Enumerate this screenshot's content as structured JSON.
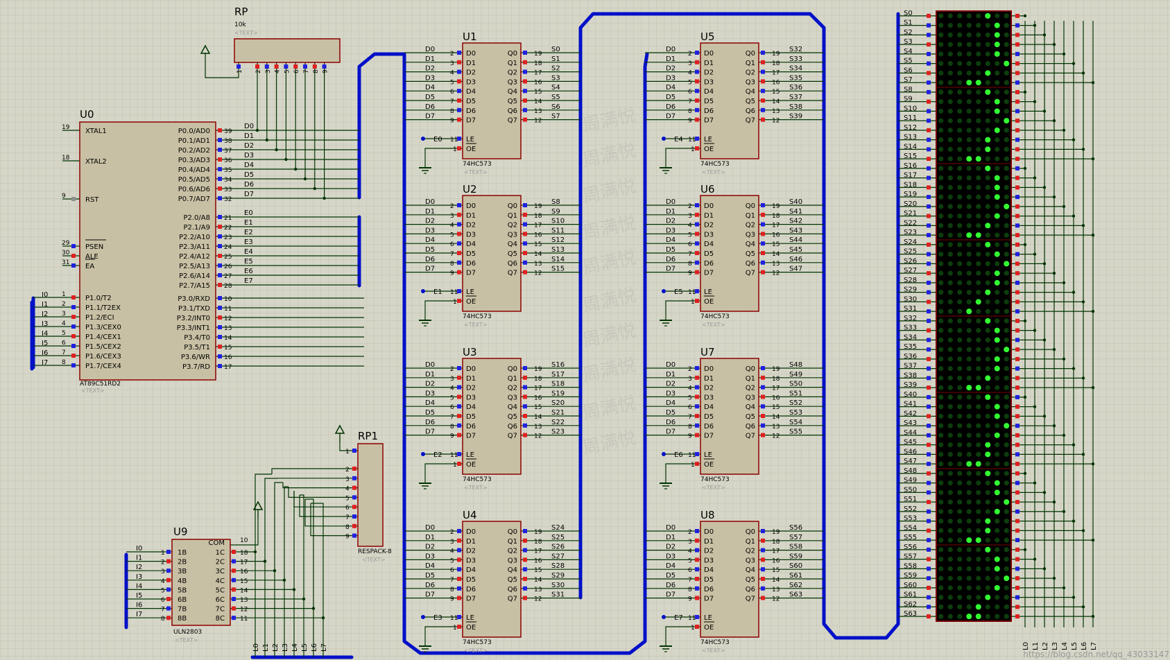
{
  "schematic": {
    "mcu": {
      "ref": "U0",
      "part": "AT89C51RD2",
      "text_placeholder": "<TEXT>",
      "left_pins": [
        {
          "num": "19",
          "name": "XTAL1"
        },
        {
          "num": "18",
          "name": "XTAL2"
        },
        {
          "num": "9",
          "name": "RST"
        },
        {
          "num": "29",
          "name": "PSEN"
        },
        {
          "num": "30",
          "name": "ALE"
        },
        {
          "num": "31",
          "name": "EA"
        },
        {
          "num": "1",
          "name": "P1.0/T2"
        },
        {
          "num": "2",
          "name": "P1.1/T2EX"
        },
        {
          "num": "3",
          "name": "P1.2/ECI"
        },
        {
          "num": "4",
          "name": "P1.3/CEX0"
        },
        {
          "num": "5",
          "name": "P1.4/CEX1"
        },
        {
          "num": "6",
          "name": "P1.5/CEX2"
        },
        {
          "num": "7",
          "name": "P1.6/CEX3"
        },
        {
          "num": "8",
          "name": "P1.7/CEX4"
        }
      ],
      "right_pins": [
        {
          "num": "39",
          "name": "P0.0/AD0",
          "net": "D0"
        },
        {
          "num": "38",
          "name": "P0.1/AD1",
          "net": "D1"
        },
        {
          "num": "37",
          "name": "P0.2/AD2",
          "net": "D2"
        },
        {
          "num": "36",
          "name": "P0.3/AD3",
          "net": "D3"
        },
        {
          "num": "35",
          "name": "P0.4/AD4",
          "net": "D4"
        },
        {
          "num": "34",
          "name": "P0.5/AD5",
          "net": "D5"
        },
        {
          "num": "33",
          "name": "P0.6/AD6",
          "net": "D6"
        },
        {
          "num": "32",
          "name": "P0.7/AD7",
          "net": "D7"
        },
        {
          "num": "21",
          "name": "P2.0/A8",
          "net": "E0"
        },
        {
          "num": "22",
          "name": "P2.1/A9",
          "net": "E1"
        },
        {
          "num": "23",
          "name": "P2.2/A10",
          "net": "E2"
        },
        {
          "num": "24",
          "name": "P2.3/A11",
          "net": "E3"
        },
        {
          "num": "25",
          "name": "P2.4/A12",
          "net": "E4"
        },
        {
          "num": "26",
          "name": "P2.5/A13",
          "net": "E5"
        },
        {
          "num": "27",
          "name": "P2.6/A14",
          "net": "E6"
        },
        {
          "num": "28",
          "name": "P2.7/A15",
          "net": "E7"
        },
        {
          "num": "10",
          "name": "P3.0/RXD",
          "net": ""
        },
        {
          "num": "11",
          "name": "P3.1/TXD",
          "net": ""
        },
        {
          "num": "12",
          "name": "P3.2/INT0",
          "net": ""
        },
        {
          "num": "13",
          "name": "P3.3/INT1",
          "net": ""
        },
        {
          "num": "14",
          "name": "P3.4/T0",
          "net": ""
        },
        {
          "num": "15",
          "name": "P3.5/T1",
          "net": ""
        },
        {
          "num": "16",
          "name": "P3.6/WR",
          "net": ""
        },
        {
          "num": "17",
          "name": "P3.7/RD",
          "net": ""
        }
      ],
      "p1_nets": [
        "I0",
        "I1",
        "I2",
        "I3",
        "I4",
        "I5",
        "I6",
        "I7"
      ]
    },
    "rp": {
      "ref": "RP",
      "value": "10k",
      "text_placeholder": "<TEXT>",
      "pins": [
        "1",
        "2",
        "3",
        "4",
        "5",
        "6",
        "7",
        "8",
        "9"
      ]
    },
    "rp1": {
      "ref": "RP1",
      "part": "RESPACK-8",
      "text_placeholder": "<TEXT>",
      "pins": [
        "1",
        "2",
        "3",
        "4",
        "5",
        "6",
        "7",
        "8",
        "9"
      ]
    },
    "uln": {
      "ref": "U9",
      "part": "ULN2803",
      "text_placeholder": "<TEXT>",
      "in_pins": [
        {
          "num": "1",
          "name": "1B",
          "net": "I0"
        },
        {
          "num": "2",
          "name": "2B",
          "net": "I1"
        },
        {
          "num": "3",
          "name": "3B",
          "net": "I2"
        },
        {
          "num": "4",
          "name": "4B",
          "net": "I3"
        },
        {
          "num": "5",
          "name": "5B",
          "net": "I4"
        },
        {
          "num": "6",
          "name": "6B",
          "net": "I5"
        },
        {
          "num": "7",
          "name": "7B",
          "net": "I6"
        },
        {
          "num": "8",
          "name": "8B",
          "net": "I7"
        }
      ],
      "com": {
        "num": "10",
        "name": "COM"
      },
      "out_pins": [
        {
          "num": "18",
          "name": "1C"
        },
        {
          "num": "17",
          "name": "2C"
        },
        {
          "num": "16",
          "name": "3C"
        },
        {
          "num": "15",
          "name": "4C"
        },
        {
          "num": "14",
          "name": "5C"
        },
        {
          "num": "13",
          "name": "6C"
        },
        {
          "num": "12",
          "name": "7C"
        },
        {
          "num": "11",
          "name": "8C"
        }
      ],
      "l_nets": [
        "L0",
        "L1",
        "L2",
        "L3",
        "L4",
        "L5",
        "L6",
        "L7"
      ]
    },
    "latch_common": {
      "part": "74HC573",
      "text_placeholder": "<TEXT>",
      "d_pins": [
        "2",
        "3",
        "4",
        "5",
        "6",
        "7",
        "8",
        "9"
      ],
      "q_pins": [
        "19",
        "18",
        "17",
        "16",
        "15",
        "14",
        "13",
        "12"
      ],
      "d_names": [
        "D0",
        "D1",
        "D2",
        "D3",
        "D4",
        "D5",
        "D6",
        "D7"
      ],
      "q_names": [
        "Q0",
        "Q1",
        "Q2",
        "Q3",
        "Q4",
        "Q5",
        "Q6",
        "Q7"
      ],
      "le": {
        "num": "11",
        "name": "LE"
      },
      "oe": {
        "num": "1",
        "name": "OE"
      }
    },
    "latches": [
      {
        "ref": "U1",
        "enable": "E0",
        "outputs": [
          "S0",
          "S1",
          "S2",
          "S3",
          "S4",
          "S5",
          "S6",
          "S7"
        ]
      },
      {
        "ref": "U2",
        "enable": "E1",
        "outputs": [
          "S8",
          "S9",
          "S10",
          "S11",
          "S12",
          "S13",
          "S14",
          "S15"
        ]
      },
      {
        "ref": "U3",
        "enable": "E2",
        "outputs": [
          "S16",
          "S17",
          "S18",
          "S19",
          "S20",
          "S21",
          "S22",
          "S23"
        ]
      },
      {
        "ref": "U4",
        "enable": "E3",
        "outputs": [
          "S24",
          "S25",
          "S26",
          "S27",
          "S28",
          "S29",
          "S30",
          "S31"
        ]
      },
      {
        "ref": "U5",
        "enable": "E4",
        "outputs": [
          "S32",
          "S33",
          "S34",
          "S35",
          "S36",
          "S37",
          "S38",
          "S39"
        ]
      },
      {
        "ref": "U6",
        "enable": "E5",
        "outputs": [
          "S40",
          "S41",
          "S42",
          "S43",
          "S44",
          "S45",
          "S46",
          "S47"
        ]
      },
      {
        "ref": "U7",
        "enable": "E6",
        "outputs": [
          "S48",
          "S49",
          "S50",
          "S51",
          "S52",
          "S53",
          "S54",
          "S55"
        ]
      },
      {
        "ref": "U8",
        "enable": "E7",
        "outputs": [
          "S56",
          "S57",
          "S58",
          "S59",
          "S60",
          "S61",
          "S62",
          "S63"
        ]
      }
    ],
    "matrix": {
      "rows": 64,
      "cols": 8,
      "bottom_nets": [
        "L0",
        "L1",
        "L2",
        "L3",
        "L4",
        "L5",
        "L6",
        "L7"
      ],
      "lit": [
        [
          0,
          5
        ],
        [
          1,
          6
        ],
        [
          2,
          6
        ],
        [
          3,
          6
        ],
        [
          4,
          6
        ],
        [
          5,
          7
        ],
        [
          6,
          5
        ],
        [
          7,
          3
        ],
        [
          7,
          4
        ],
        [
          8,
          5
        ],
        [
          9,
          6
        ],
        [
          10,
          6
        ],
        [
          11,
          7
        ],
        [
          12,
          6
        ],
        [
          13,
          5
        ],
        [
          14,
          5
        ],
        [
          15,
          3
        ],
        [
          15,
          4
        ],
        [
          16,
          5
        ],
        [
          17,
          6
        ],
        [
          18,
          6
        ],
        [
          19,
          6
        ],
        [
          20,
          7
        ],
        [
          21,
          6
        ],
        [
          22,
          5
        ],
        [
          23,
          3
        ],
        [
          23,
          4
        ],
        [
          24,
          5
        ],
        [
          25,
          6
        ],
        [
          26,
          7
        ],
        [
          27,
          6
        ],
        [
          28,
          6
        ],
        [
          29,
          5
        ],
        [
          30,
          4
        ],
        [
          31,
          3
        ],
        [
          32,
          5
        ],
        [
          33,
          6
        ],
        [
          34,
          6
        ],
        [
          35,
          7
        ],
        [
          36,
          6
        ],
        [
          37,
          6
        ],
        [
          38,
          5
        ],
        [
          39,
          3
        ],
        [
          39,
          4
        ],
        [
          40,
          5
        ],
        [
          41,
          6
        ],
        [
          42,
          6
        ],
        [
          43,
          7
        ],
        [
          44,
          6
        ],
        [
          45,
          5
        ],
        [
          46,
          5
        ],
        [
          47,
          3
        ],
        [
          47,
          4
        ],
        [
          48,
          5
        ],
        [
          49,
          6
        ],
        [
          50,
          6
        ],
        [
          51,
          7
        ],
        [
          52,
          6
        ],
        [
          53,
          5
        ],
        [
          54,
          5
        ],
        [
          55,
          3
        ],
        [
          55,
          4
        ],
        [
          56,
          5
        ],
        [
          57,
          6
        ],
        [
          58,
          6
        ],
        [
          59,
          7
        ],
        [
          60,
          6
        ],
        [
          61,
          5
        ],
        [
          62,
          4
        ],
        [
          63,
          3
        ],
        [
          63,
          4
        ]
      ]
    },
    "watermark": "周满悦",
    "credit": "https://blog.csdn.net/qq_43033147",
    "colors": {
      "background": "#d6d6c8",
      "grid": "#c4c4b4",
      "component_fill": "#c8c0a4",
      "component_border": "#8b0000",
      "wire": "#003300",
      "bus": "#0010c8",
      "pin_red": "#e02020",
      "pin_blue": "#2020e0",
      "led_off": "#0d3d0d",
      "led_on": "#33ff33",
      "matrix_bg": "#000000"
    }
  }
}
